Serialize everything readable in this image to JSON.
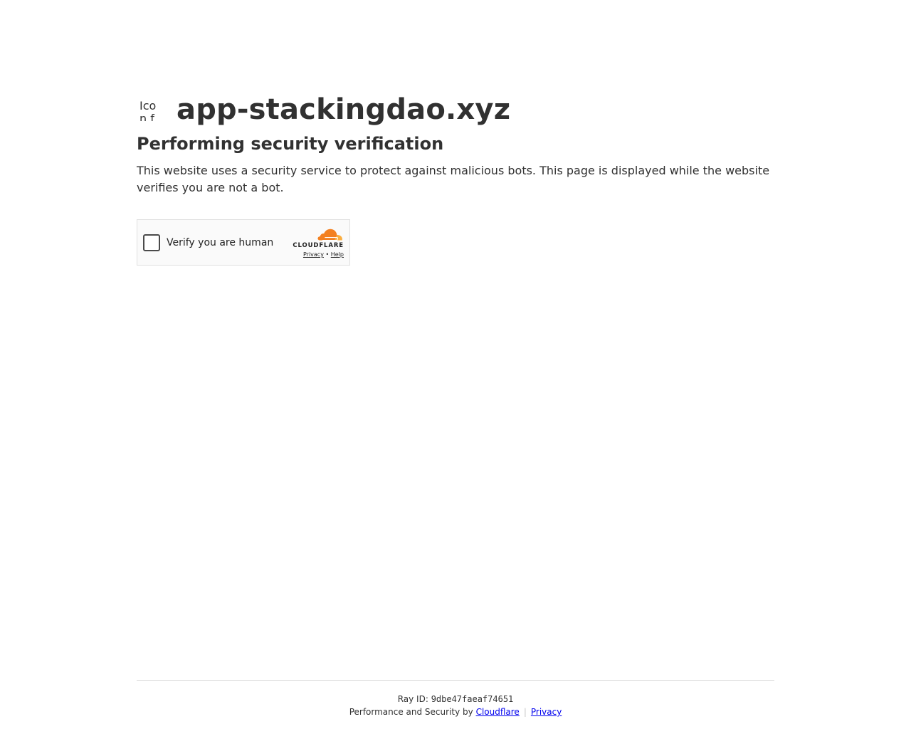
{
  "site": {
    "favicon_alt": "Icon for app-stackingdao.xyz",
    "name": "app-stackingdao.xyz"
  },
  "main": {
    "heading": "Performing security verification",
    "description": "This website uses a security service to protect against malicious bots. This page is displayed while the website verifies you are not a bot."
  },
  "widget": {
    "label": "Verify you are human",
    "checked": false,
    "brand": "CLOUDFLARE",
    "privacy_link": "Privacy",
    "bullet": "•",
    "help_link": "Help",
    "brand_colors": {
      "cloud_dark": "#f38020",
      "cloud_light": "#faae40"
    }
  },
  "footer": {
    "ray_label": "Ray ID: ",
    "ray_id": "9dbe47faeaf74651",
    "perf_text": "Performance and Security by ",
    "cloudflare_link": "Cloudflare",
    "separator": "|",
    "privacy_link": "Privacy"
  },
  "colors": {
    "text": "#313131",
    "link": "#0000ee",
    "divider": "#d9d9d9"
  }
}
